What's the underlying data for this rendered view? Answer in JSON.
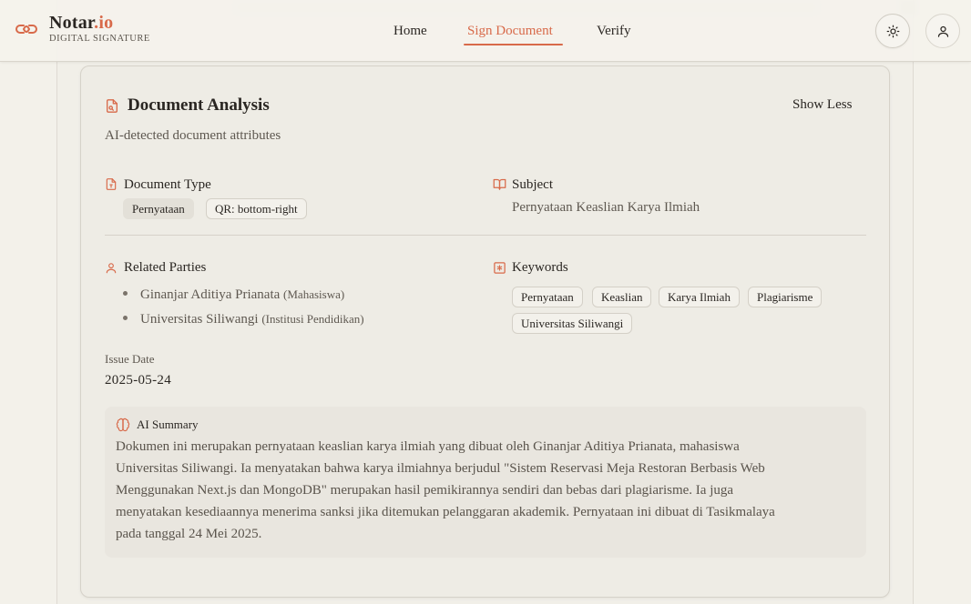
{
  "brand": {
    "name_main": "Notar",
    "name_accent": ".io",
    "subtitle": "DIGITAL SIGNATURE"
  },
  "nav": {
    "home": "Home",
    "sign": "Sign Document",
    "verify": "Verify",
    "active": "Sign Document"
  },
  "colors": {
    "accent": "#d86a4a",
    "background": "#f3f1ea",
    "card": "#eeece5",
    "text": "#2a2622",
    "muted": "#5e5850"
  },
  "card": {
    "title": "Document Analysis",
    "toggle": "Show Less",
    "subtitle": "AI-detected document attributes",
    "document_type": {
      "label": "Document Type",
      "chips": [
        "Pernyataan",
        "QR: bottom-right"
      ]
    },
    "subject": {
      "label": "Subject",
      "value": "Pernyataan Keaslian Karya Ilmiah"
    },
    "related_parties": {
      "label": "Related Parties",
      "items": [
        {
          "name": "Ginanjar Aditiya Prianata",
          "role": "(Mahasiswa)"
        },
        {
          "name": "Universitas Siliwangi",
          "role": "(Institusi Pendidikan)"
        }
      ]
    },
    "keywords": {
      "label": "Keywords",
      "items": [
        "Pernyataan",
        "Keaslian",
        "Karya Ilmiah",
        "Plagiarisme",
        "Universitas Siliwangi"
      ]
    },
    "issue_date": {
      "label": "Issue Date",
      "value": "2025-05-24"
    },
    "summary": {
      "title": "AI Summary",
      "lines": [
        "Dokumen ini merupakan pernyataan keaslian karya ilmiah yang dibuat oleh Ginanjar Aditiya Prianata, mahasiswa",
        "Universitas Siliwangi. Ia menyatakan bahwa karya ilmiahnya berjudul \"Sistem Reservasi Meja Restoran Berbasis Web",
        "Menggunakan Next.js dan MongoDB\" merupakan hasil pemikirannya sendiri dan bebas dari plagiarisme. Ia juga",
        "menyatakan kesediaannya menerima sanksi jika ditemukan pelanggaran akademik. Pernyataan ini dibuat di Tasikmalaya",
        "pada tanggal 24 Mei 2025."
      ]
    }
  },
  "icons": {
    "logo": "signature-logo-icon",
    "theme": "sun-icon",
    "user": "user-icon",
    "document_analysis": "file-search-icon",
    "document_type": "file-text-icon",
    "subject": "book-open-icon",
    "related_parties": "user-icon",
    "keywords": "asterisk-square-icon",
    "summary": "brain-icon"
  }
}
